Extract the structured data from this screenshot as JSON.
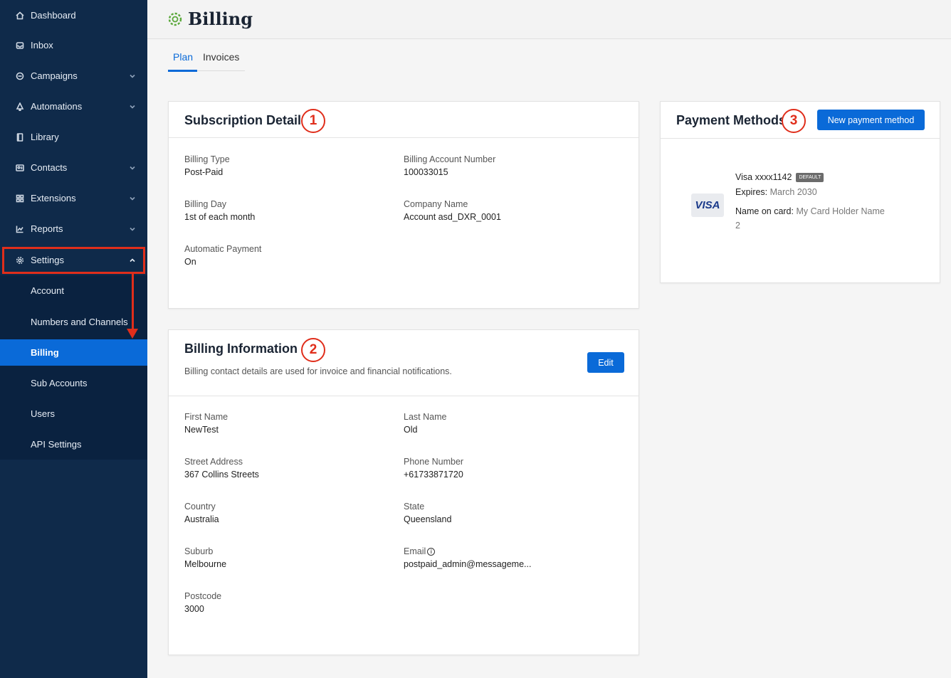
{
  "sidebar": {
    "items": [
      {
        "label": "Dashboard",
        "icon": "home-icon"
      },
      {
        "label": "Inbox",
        "icon": "inbox-icon"
      },
      {
        "label": "Campaigns",
        "icon": "campaigns-icon"
      },
      {
        "label": "Automations",
        "icon": "automations-icon"
      },
      {
        "label": "Library",
        "icon": "library-icon"
      },
      {
        "label": "Contacts",
        "icon": "contacts-icon"
      },
      {
        "label": "Extensions",
        "icon": "extensions-icon"
      },
      {
        "label": "Reports",
        "icon": "reports-icon"
      },
      {
        "label": "Settings",
        "icon": "settings-gear-icon"
      }
    ],
    "settings_sub": [
      {
        "label": "Account"
      },
      {
        "label": "Numbers and Channels"
      },
      {
        "label": "Billing"
      },
      {
        "label": "Sub Accounts"
      },
      {
        "label": "Users"
      },
      {
        "label": "API Settings"
      }
    ]
  },
  "header": {
    "title": "Billing"
  },
  "tabs": [
    {
      "label": "Plan"
    },
    {
      "label": "Invoices"
    }
  ],
  "subscription": {
    "title": "Subscription Details",
    "callout": "1",
    "billing_type_label": "Billing Type",
    "billing_type": "Post-Paid",
    "account_number_label": "Billing Account Number",
    "account_number": "100033015",
    "billing_day_label": "Billing Day",
    "billing_day": "1st of each month",
    "company_label": "Company Name",
    "company": "Account asd_DXR_0001",
    "auto_payment_label": "Automatic Payment",
    "auto_payment": "On"
  },
  "billing_info": {
    "title": "Billing Information",
    "callout": "2",
    "description": "Billing contact details are used for invoice and financial notifications.",
    "edit_label": "Edit",
    "first_name_label": "First Name",
    "first_name": "NewTest",
    "last_name_label": "Last Name",
    "last_name": "Old",
    "street_label": "Street Address",
    "street": "367 Collins Streets",
    "phone_label": "Phone Number",
    "phone": "+61733871720",
    "country_label": "Country",
    "country": "Australia",
    "state_label": "State",
    "state": "Queensland",
    "suburb_label": "Suburb",
    "suburb": "Melbourne",
    "email_label": "Email",
    "email": "postpaid_admin@messageme...",
    "postcode_label": "Postcode",
    "postcode": "3000"
  },
  "payment": {
    "title": "Payment Methods",
    "callout": "3",
    "new_button": "New payment method",
    "card_brand_logo": "VISA",
    "card_number": "Visa xxxx1142",
    "default_tag": "DEFAULT",
    "expires_label": "Expires:",
    "expires": "March 2030",
    "name_label": "Name on card:",
    "name": "My Card Holder Name",
    "name_line2": "2"
  },
  "colors": {
    "sidebar": "#0f2a4a",
    "accent": "#0a6ad8",
    "callout": "#e02e1b"
  }
}
